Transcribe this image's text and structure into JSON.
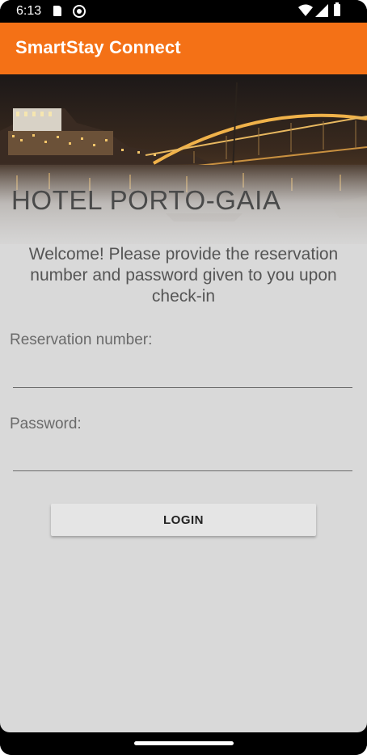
{
  "status_bar": {
    "time": "6:13",
    "icons": [
      "sd-card-icon",
      "sync-icon",
      "wifi-icon",
      "signal-icon",
      "battery-icon"
    ]
  },
  "app_bar": {
    "title": "SmartStay Connect",
    "color": "#f47116"
  },
  "hero": {
    "hotel_name": "HOTEL PORTO-GAIA"
  },
  "login_form": {
    "welcome_message": "Welcome! Please provide the reservation number and password given to you upon check-in",
    "reservation_label": "Reservation number:",
    "reservation_value": "",
    "password_label": "Password:",
    "password_value": "",
    "login_button_label": "LOGIN"
  }
}
